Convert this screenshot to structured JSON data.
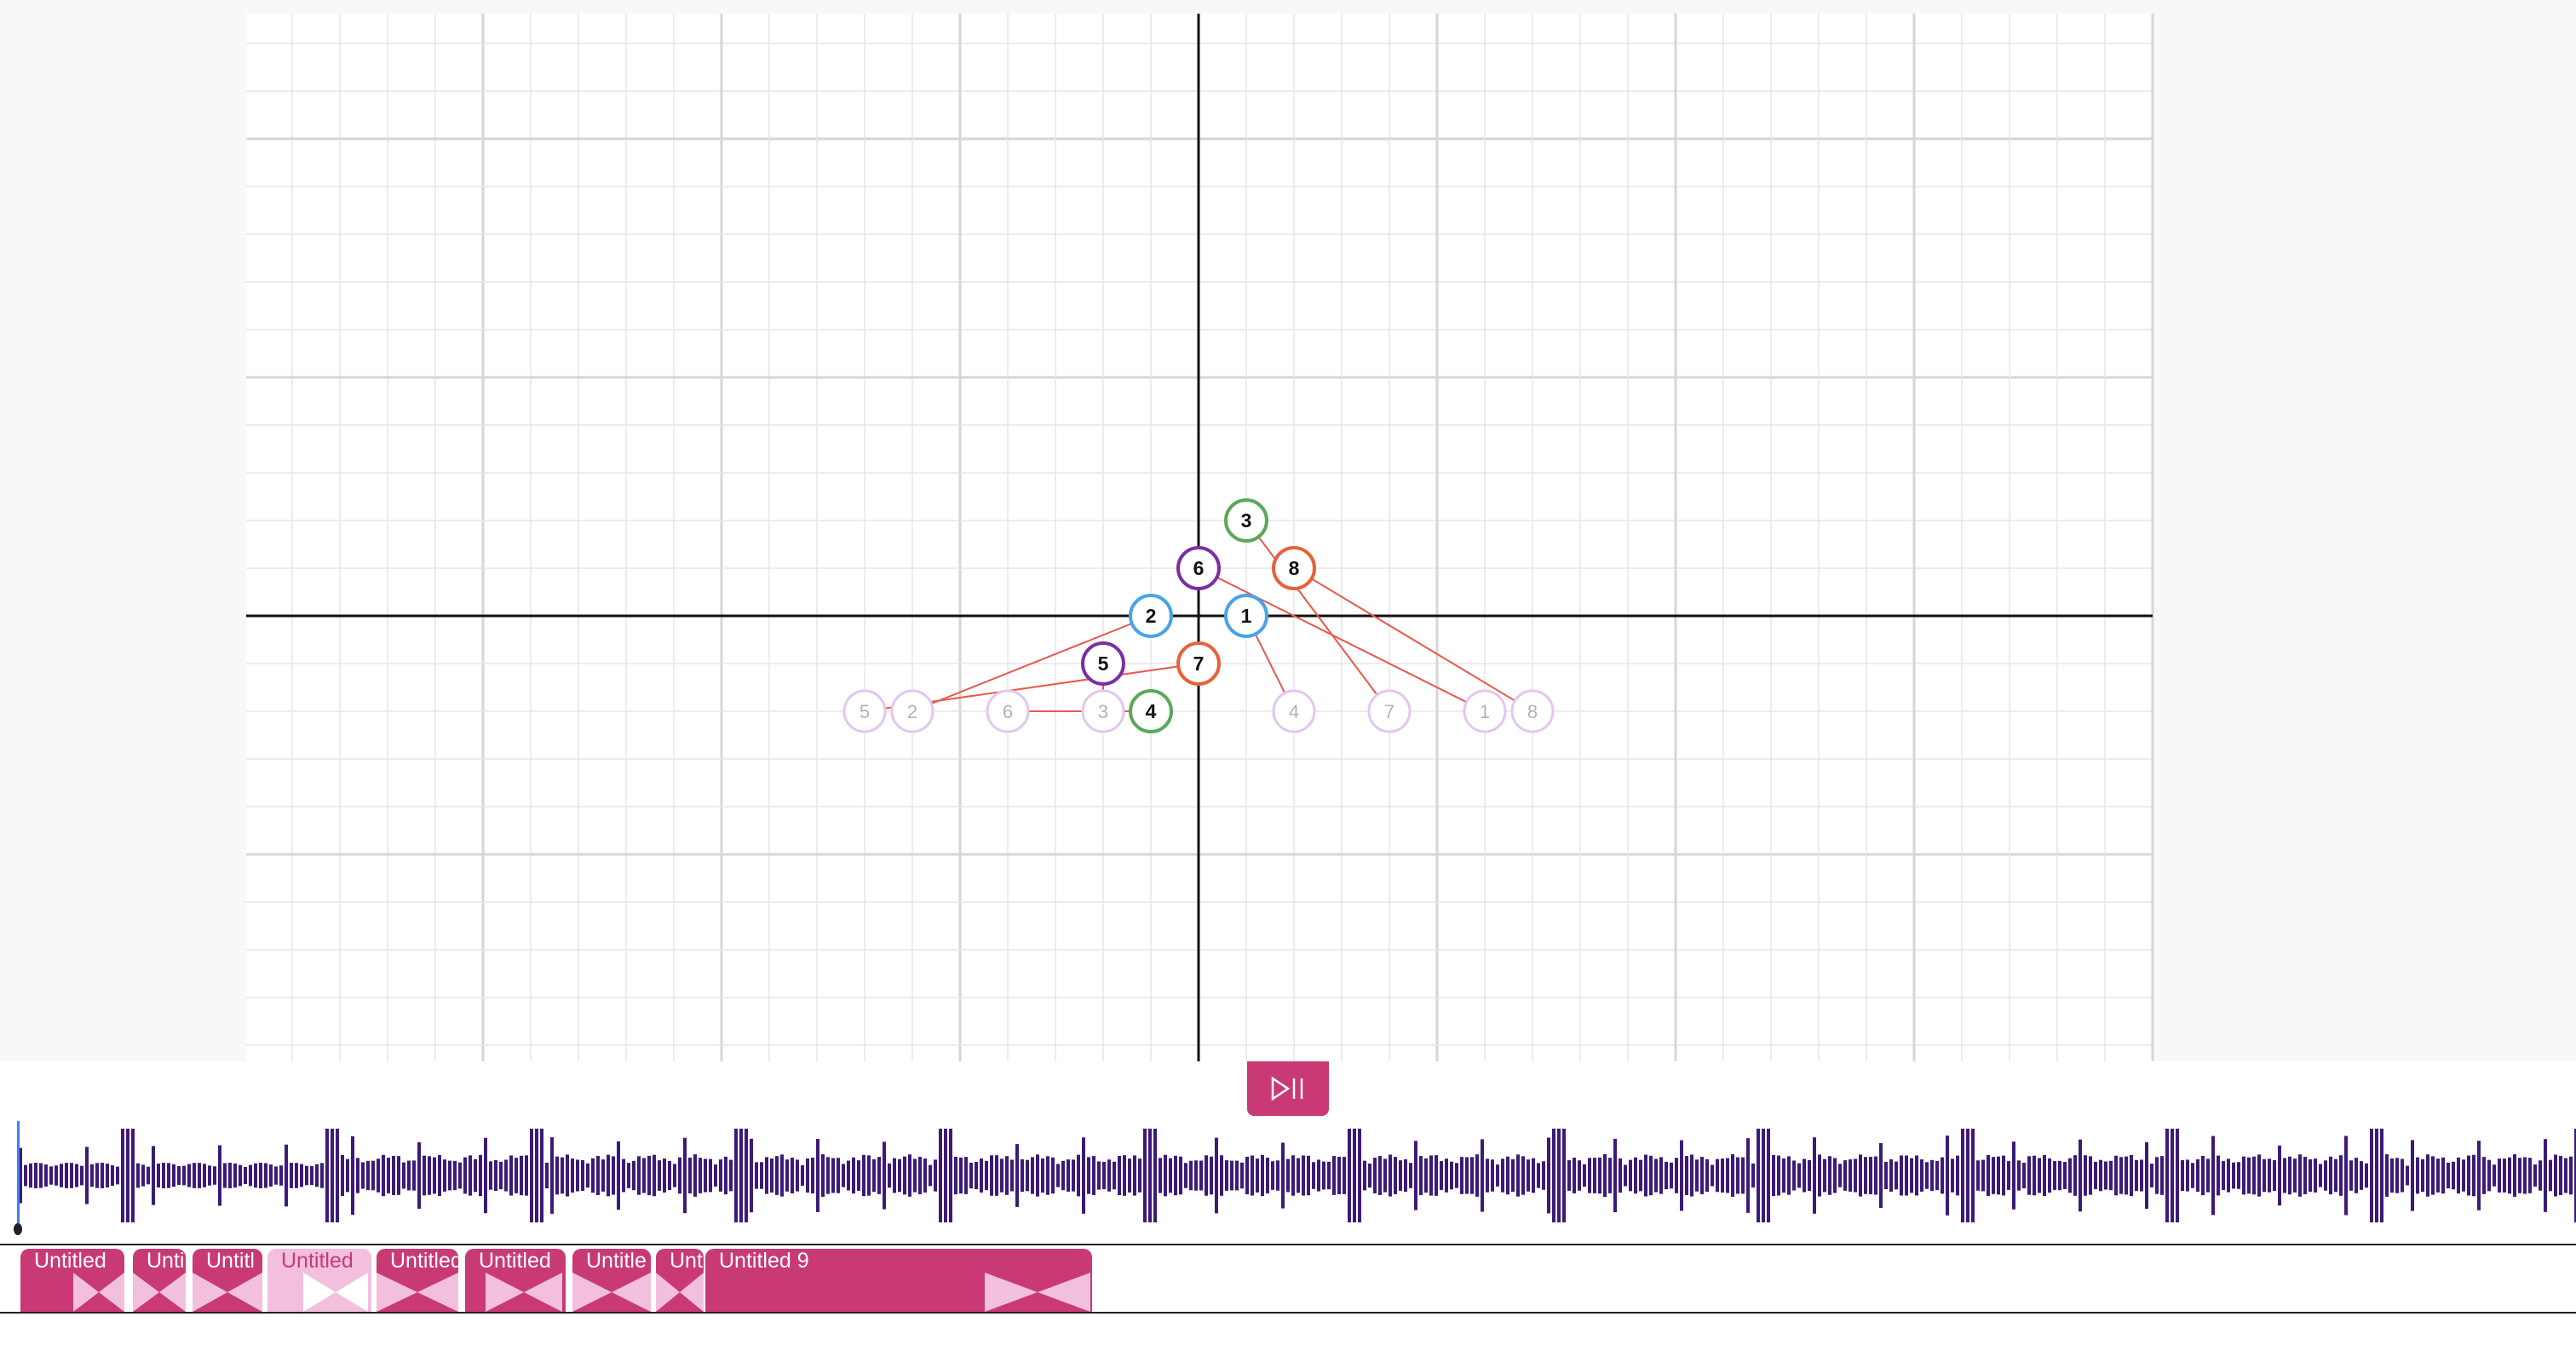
{
  "grid": {
    "colors": {
      "background": "#ffffff",
      "minor_line": "#e6e6e6",
      "major_line": "#d6d6d6",
      "axis": "#111111",
      "connector": "#e8574b"
    }
  },
  "nodes": [
    {
      "label": "1",
      "state": "active",
      "color": "#4aa3e6"
    },
    {
      "label": "2",
      "state": "active",
      "color": "#4aa3e6"
    },
    {
      "label": "3",
      "state": "active",
      "color": "#5ba85a"
    },
    {
      "label": "4",
      "state": "active",
      "color": "#5ba85a"
    },
    {
      "label": "5",
      "state": "active",
      "color": "#7b2fa2"
    },
    {
      "label": "6",
      "state": "active",
      "color": "#7b2fa2"
    },
    {
      "label": "7",
      "state": "active",
      "color": "#e8613c"
    },
    {
      "label": "8",
      "state": "active",
      "color": "#e8613c"
    }
  ],
  "ghost_nodes": [
    {
      "label": "5"
    },
    {
      "label": "2"
    },
    {
      "label": "6"
    },
    {
      "label": "3"
    },
    {
      "label": "4"
    },
    {
      "label": "7"
    },
    {
      "label": "1"
    },
    {
      "label": "8"
    }
  ],
  "transport": {
    "play_pause_icon": "play-pause-icon",
    "accent_color": "#c93a74"
  },
  "waveform": {
    "color": "#3d1a78",
    "playhead_color": "#3b82f6"
  },
  "clips": [
    {
      "label": "Untitled",
      "selected": false
    },
    {
      "label": "Unti",
      "selected": false
    },
    {
      "label": "Untitl",
      "selected": false
    },
    {
      "label": "Untitled",
      "selected": true
    },
    {
      "label": "Untitled",
      "selected": false
    },
    {
      "label": "Untitled",
      "selected": false
    },
    {
      "label": "Untitle",
      "selected": false
    },
    {
      "label": "Unt",
      "selected": false
    },
    {
      "label": "Untitled 9",
      "selected": false
    }
  ]
}
